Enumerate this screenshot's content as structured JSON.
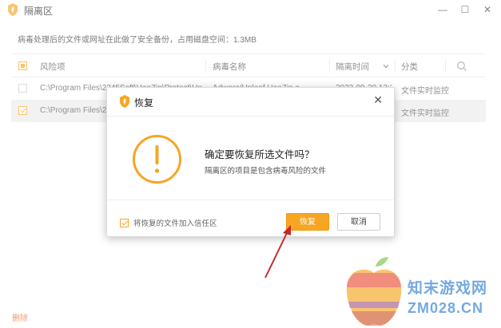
{
  "window": {
    "title": "隔离区",
    "controls": {
      "minimize": "—",
      "maximize": "☐",
      "close": "✕"
    }
  },
  "storage_info": "病毒处理后的文件或网址在此做了安全备份，占用磁盘空间：1.3MB",
  "table": {
    "columns": {
      "risk_item": "风险项",
      "virus_name": "病毒名称",
      "isolation_time": "隔离时间",
      "category": "分类"
    },
    "rows": [
      {
        "path": "C:\\Program Files\\2345Soft\\HaoZip\\Protect\\Ho",
        "virus": "Adware/Unleaf.HaoZip.a",
        "time": "2023-09-20 12:2",
        "category": "文件实时监控",
        "selected": false
      },
      {
        "path": "C:\\Program Files\\2",
        "virus": "",
        "time": "2",
        "category": "文件实时监控",
        "selected": true
      }
    ]
  },
  "footer": {
    "delete_label": "删除"
  },
  "dialog": {
    "title": "恢复",
    "heading": "确定要恢复所选文件吗？",
    "subtext": "隔离区的项目是包含病毒风险的文件",
    "trust_label": "将恢复的文件加入信任区",
    "confirm_label": "恢复",
    "cancel_label": "取消"
  },
  "watermark": {
    "name": "知末游戏网",
    "url": "ZM028.CN"
  },
  "colors": {
    "accent": "#f6a623",
    "delete_link": "#e8632c",
    "watermark": "#2a7bd1"
  }
}
